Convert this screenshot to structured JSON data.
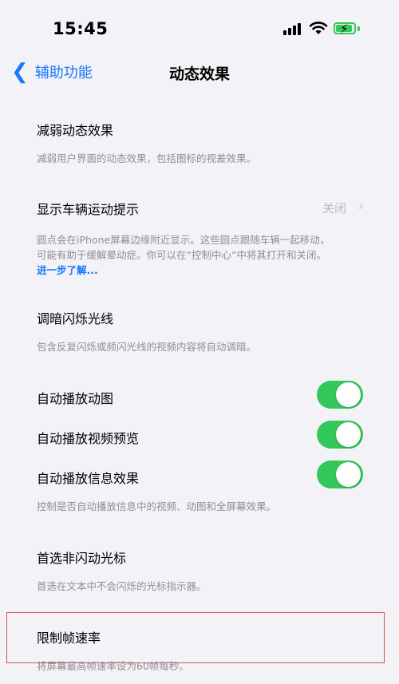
{
  "status_bar": {
    "time": "15:45"
  },
  "nav": {
    "back_label": "辅助功能",
    "title": "动态效果"
  },
  "sections": {
    "reduce_motion": {
      "label": "减弱动态效果",
      "description": "减弱用户界面的动态效果，包括图标的视差效果。"
    },
    "vehicle": {
      "label": "显示车辆运动提示",
      "value": "关闭",
      "description_line1": "圆点会在iPhone屏幕边缘附近显示。这些圆点跟随车辆一起移动，",
      "description_line2": "可能有助于缓解晕动症。你可以在“控制中心”中将其打开和关闭。",
      "link": "进一步了解..."
    },
    "dim_flash": {
      "label": "调暗闪烁光线",
      "description": "包含反复闪烁或频闪光线的视频内容将自动调暗。"
    },
    "autoplay_gif": {
      "label": "自动播放动图",
      "on": true
    },
    "autoplay_video": {
      "label": "自动播放视频预览",
      "on": true
    },
    "autoplay_message": {
      "label": "自动播放信息效果",
      "on": true
    },
    "autoplay_description": "控制是否自动播放信息中的视频、动图和全屏幕效果。",
    "nonblink_cursor": {
      "label": "首选非闪动光标",
      "description": "首选在文本中不会闪烁的光标指示器。"
    },
    "limit_frame": {
      "label": "限制帧速率",
      "description": "将屏幕最高帧速率设为60帧每秒。"
    }
  },
  "colors": {
    "accent": "#1677ff",
    "toggle_on": "#34c759",
    "highlight_border": "#d9534f"
  }
}
